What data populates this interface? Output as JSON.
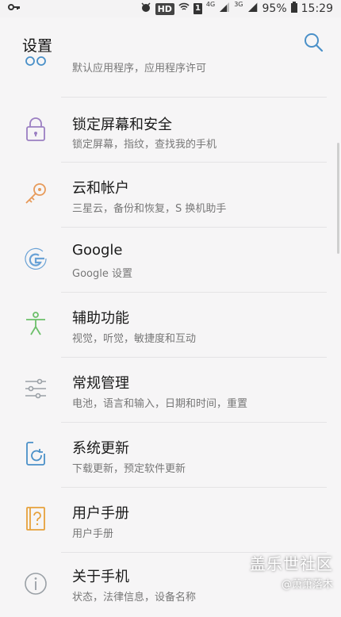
{
  "status_bar": {
    "left_icon": "key-icon",
    "hd": "HD",
    "sim": "1",
    "net1": "4G",
    "net2": "3G",
    "battery": "95%",
    "time": "15:29"
  },
  "header": {
    "title": "设置",
    "search_icon": "search-icon"
  },
  "items": [
    {
      "label": "",
      "sub": "默认应用程序，应用程序许可",
      "icon": "apps-icon"
    },
    {
      "label": "锁定屏幕和安全",
      "sub": "锁定屏幕，指纹，查找我的手机",
      "icon": "lock-icon"
    },
    {
      "label": "云和帐户",
      "sub": "三星云，备份和恢复，S 换机助手",
      "icon": "key-icon"
    },
    {
      "label": "Google",
      "sub": "Google 设置",
      "icon": "google-icon"
    },
    {
      "label": "辅助功能",
      "sub": "视觉，听觉，敏捷度和互动",
      "icon": "accessibility-icon"
    },
    {
      "label": "常规管理",
      "sub": "电池，语言和输入，日期和时间，重置",
      "icon": "sliders-icon"
    },
    {
      "label": "系统更新",
      "sub": "下载更新，预定软件更新",
      "icon": "update-icon"
    },
    {
      "label": "用户手册",
      "sub": "用户手册",
      "icon": "manual-icon"
    },
    {
      "label": "关于手机",
      "sub": "状态，法律信息，设备名称",
      "icon": "info-icon"
    }
  ],
  "watermark": {
    "line1": "盖乐世社区",
    "line2": "@萧萧落木"
  },
  "colors": {
    "background": "#f6f5f6",
    "search": "#4a90c8",
    "lock": "#9b7fc2",
    "key": "#e79a5a",
    "google": "#6aa2d6",
    "accessibility": "#6cbf6a",
    "sliders": "#9aa0a6",
    "update": "#4a90c8",
    "manual": "#e6a13c",
    "info": "#9aa0a6"
  }
}
